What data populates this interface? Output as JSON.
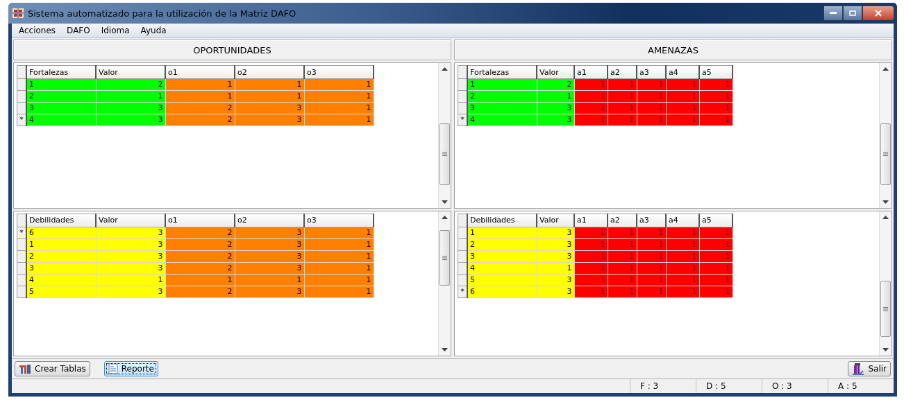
{
  "window": {
    "title": "Sistema automatizado para la utilización de la Matriz DAFO"
  },
  "menu": [
    "Acciones",
    "DAFO",
    "Idioma",
    "Ayuda"
  ],
  "panels": [
    {
      "title": "OPORTUNIDADES",
      "grids": [
        {
          "columns": [
            {
              "label": "Fortalezas",
              "color": "#00ff00"
            },
            {
              "label": "Valor",
              "color": "#00ff00"
            },
            {
              "label": "o1",
              "color": "#ff8000"
            },
            {
              "label": "o2",
              "color": "#ff8000"
            },
            {
              "label": "o3",
              "color": "#ff8000"
            }
          ],
          "rows": [
            {
              "marker": "",
              "cells": [
                "1",
                "2",
                "1",
                "1",
                "1"
              ]
            },
            {
              "marker": "",
              "cells": [
                "2",
                "1",
                "1",
                "1",
                "1"
              ]
            },
            {
              "marker": "",
              "cells": [
                "3",
                "3",
                "2",
                "3",
                "1"
              ]
            },
            {
              "marker": "*",
              "cells": [
                "4",
                "3",
                "2",
                "3",
                "1"
              ]
            }
          ]
        },
        {
          "columns": [
            {
              "label": "Debilidades",
              "color": "#ffff00"
            },
            {
              "label": "Valor",
              "color": "#ffff00"
            },
            {
              "label": "o1",
              "color": "#ff8000"
            },
            {
              "label": "o2",
              "color": "#ff8000"
            },
            {
              "label": "o3",
              "color": "#ff8000"
            }
          ],
          "rows": [
            {
              "marker": "*",
              "cells": [
                "6",
                "3",
                "2",
                "3",
                "1"
              ]
            },
            {
              "marker": "",
              "cells": [
                "1",
                "3",
                "2",
                "3",
                "1"
              ]
            },
            {
              "marker": "",
              "cells": [
                "2",
                "3",
                "2",
                "3",
                "1"
              ]
            },
            {
              "marker": "",
              "cells": [
                "3",
                "3",
                "2",
                "3",
                "1"
              ]
            },
            {
              "marker": "",
              "cells": [
                "4",
                "1",
                "1",
                "1",
                "1"
              ]
            },
            {
              "marker": "",
              "cells": [
                "5",
                "3",
                "2",
                "3",
                "1"
              ]
            }
          ]
        }
      ]
    },
    {
      "title": "AMENAZAS",
      "grids": [
        {
          "columns": [
            {
              "label": "Fortalezas",
              "color": "#00ff00"
            },
            {
              "label": "Valor",
              "color": "#00ff00"
            },
            {
              "label": "a1",
              "color": "#ff0000"
            },
            {
              "label": "a2",
              "color": "#ff0000"
            },
            {
              "label": "a3",
              "color": "#ff0000"
            },
            {
              "label": "a4",
              "color": "#ff0000"
            },
            {
              "label": "a5",
              "color": "#ff0000"
            }
          ],
          "rows": [
            {
              "marker": "",
              "cells": [
                "1",
                "2",
                "1",
                "1",
                "1",
                "1",
                "1"
              ]
            },
            {
              "marker": "",
              "cells": [
                "2",
                "1",
                "1",
                "1",
                "1",
                "1",
                "1"
              ]
            },
            {
              "marker": "",
              "cells": [
                "3",
                "3",
                "1",
                "1",
                "1",
                "1",
                "1"
              ]
            },
            {
              "marker": "*",
              "cells": [
                "4",
                "3",
                "1",
                "1",
                "1",
                "1",
                "1"
              ]
            }
          ]
        },
        {
          "columns": [
            {
              "label": "Debilidades",
              "color": "#ffff00"
            },
            {
              "label": "Valor",
              "color": "#ffff00"
            },
            {
              "label": "a1",
              "color": "#ff0000"
            },
            {
              "label": "a2",
              "color": "#ff0000"
            },
            {
              "label": "a3",
              "color": "#ff0000"
            },
            {
              "label": "a4",
              "color": "#ff0000"
            },
            {
              "label": "a5",
              "color": "#ff0000"
            }
          ],
          "rows": [
            {
              "marker": "",
              "cells": [
                "1",
                "3",
                "1",
                "1",
                "1",
                "1",
                "1"
              ]
            },
            {
              "marker": "",
              "cells": [
                "2",
                "3",
                "1",
                "1",
                "1",
                "1",
                "1"
              ]
            },
            {
              "marker": "",
              "cells": [
                "3",
                "3",
                "1",
                "1",
                "1",
                "1",
                "1"
              ]
            },
            {
              "marker": "",
              "cells": [
                "4",
                "1",
                "1",
                "1",
                "1",
                "1",
                "1"
              ]
            },
            {
              "marker": "",
              "cells": [
                "5",
                "3",
                "1",
                "1",
                "1",
                "1",
                "1"
              ]
            },
            {
              "marker": "*",
              "cells": [
                "6",
                "3",
                "1",
                "1",
                "1",
                "1",
                "1"
              ]
            }
          ]
        }
      ]
    }
  ],
  "buttons": [
    {
      "kind": "tables",
      "label": "Crear Tablas",
      "focused": false
    },
    {
      "kind": "report",
      "label": "Reporte",
      "focused": true
    }
  ],
  "exit_button": {
    "label": "Salir"
  },
  "status_bar": [
    "F : 3",
    "D : 5",
    "O : 3",
    "A : 5"
  ]
}
